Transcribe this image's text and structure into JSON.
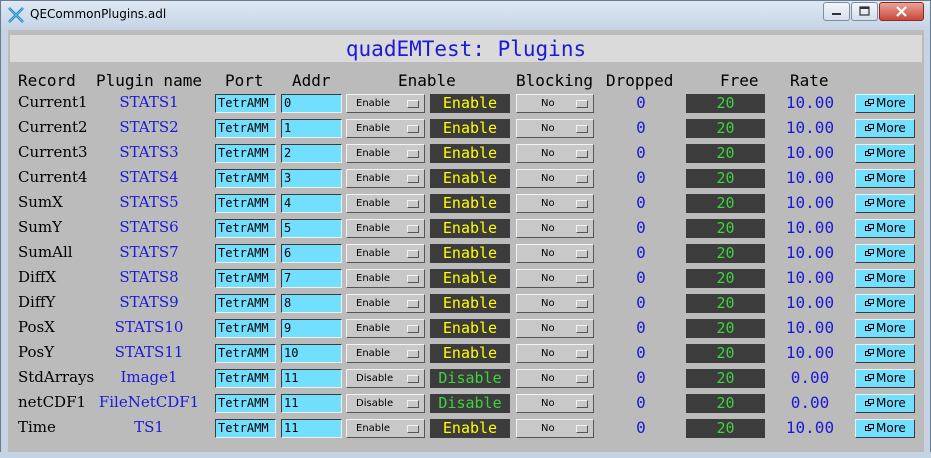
{
  "window": {
    "title": "QECommonPlugins.adl",
    "controls": [
      "minimize-icon",
      "maximize-icon",
      "close-icon"
    ]
  },
  "heading": "quadEMTest: Plugins",
  "columns": {
    "record": "Record",
    "plugin": "Plugin name",
    "port": "Port",
    "addr": "Addr",
    "enable": "Enable",
    "blocking": "Blocking",
    "dropped": "Dropped",
    "free": "Free",
    "rate": "Rate"
  },
  "rows": [
    {
      "record": "Current1",
      "plugin": "STATS1",
      "port": "TetrAMM",
      "addr": "0",
      "enable_menu": "Enable",
      "enable_status": "Enable",
      "blocking": "No",
      "dropped": "0",
      "free": "20",
      "rate": "10.00",
      "more": "More"
    },
    {
      "record": "Current2",
      "plugin": "STATS2",
      "port": "TetrAMM",
      "addr": "1",
      "enable_menu": "Enable",
      "enable_status": "Enable",
      "blocking": "No",
      "dropped": "0",
      "free": "20",
      "rate": "10.00",
      "more": "More"
    },
    {
      "record": "Current3",
      "plugin": "STATS3",
      "port": "TetrAMM",
      "addr": "2",
      "enable_menu": "Enable",
      "enable_status": "Enable",
      "blocking": "No",
      "dropped": "0",
      "free": "20",
      "rate": "10.00",
      "more": "More"
    },
    {
      "record": "Current4",
      "plugin": "STATS4",
      "port": "TetrAMM",
      "addr": "3",
      "enable_menu": "Enable",
      "enable_status": "Enable",
      "blocking": "No",
      "dropped": "0",
      "free": "20",
      "rate": "10.00",
      "more": "More"
    },
    {
      "record": "SumX",
      "plugin": "STATS5",
      "port": "TetrAMM",
      "addr": "4",
      "enable_menu": "Enable",
      "enable_status": "Enable",
      "blocking": "No",
      "dropped": "0",
      "free": "20",
      "rate": "10.00",
      "more": "More"
    },
    {
      "record": "SumY",
      "plugin": "STATS6",
      "port": "TetrAMM",
      "addr": "5",
      "enable_menu": "Enable",
      "enable_status": "Enable",
      "blocking": "No",
      "dropped": "0",
      "free": "20",
      "rate": "10.00",
      "more": "More"
    },
    {
      "record": "SumAll",
      "plugin": "STATS7",
      "port": "TetrAMM",
      "addr": "6",
      "enable_menu": "Enable",
      "enable_status": "Enable",
      "blocking": "No",
      "dropped": "0",
      "free": "20",
      "rate": "10.00",
      "more": "More"
    },
    {
      "record": "DiffX",
      "plugin": "STATS8",
      "port": "TetrAMM",
      "addr": "7",
      "enable_menu": "Enable",
      "enable_status": "Enable",
      "blocking": "No",
      "dropped": "0",
      "free": "20",
      "rate": "10.00",
      "more": "More"
    },
    {
      "record": "DiffY",
      "plugin": "STATS9",
      "port": "TetrAMM",
      "addr": "8",
      "enable_menu": "Enable",
      "enable_status": "Enable",
      "blocking": "No",
      "dropped": "0",
      "free": "20",
      "rate": "10.00",
      "more": "More"
    },
    {
      "record": "PosX",
      "plugin": "STATS10",
      "port": "TetrAMM",
      "addr": "9",
      "enable_menu": "Enable",
      "enable_status": "Enable",
      "blocking": "No",
      "dropped": "0",
      "free": "20",
      "rate": "10.00",
      "more": "More"
    },
    {
      "record": "PosY",
      "plugin": "STATS11",
      "port": "TetrAMM",
      "addr": "10",
      "enable_menu": "Enable",
      "enable_status": "Enable",
      "blocking": "No",
      "dropped": "0",
      "free": "20",
      "rate": "10.00",
      "more": "More"
    },
    {
      "record": "StdArrays",
      "plugin": "Image1",
      "port": "TetrAMM",
      "addr": "11",
      "enable_menu": "Disable",
      "enable_status": "Disable",
      "blocking": "No",
      "dropped": "0",
      "free": "20",
      "rate": "0.00",
      "more": "More"
    },
    {
      "record": "netCDF1",
      "plugin": "FileNetCDF1",
      "port": "TetrAMM",
      "addr": "11",
      "enable_menu": "Disable",
      "enable_status": "Disable",
      "blocking": "No",
      "dropped": "0",
      "free": "20",
      "rate": "0.00",
      "more": "More"
    },
    {
      "record": "Time",
      "plugin": "TS1",
      "port": "TetrAMM",
      "addr": "11",
      "enable_menu": "Enable",
      "enable_status": "Enable",
      "blocking": "No",
      "dropped": "0",
      "free": "20",
      "rate": "10.00",
      "more": "More"
    }
  ],
  "colors": {
    "client_bg": "#bbbbbb",
    "entry_bg": "#73dfff",
    "status_bg": "#3c3c3c",
    "enable_text": "#ffff00",
    "disable_text": "#3fd23f",
    "monitor_text": "#1a1ad8",
    "free_text": "#3fd23f"
  }
}
